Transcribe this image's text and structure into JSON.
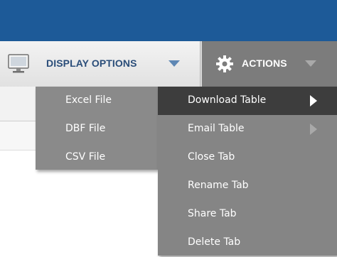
{
  "toolbar": {
    "display_options_label": "DISPLAY OPTIONS",
    "actions_label": "ACTIONS"
  },
  "actions_menu": {
    "items": [
      {
        "label": "Download Table",
        "has_submenu": true,
        "active": true
      },
      {
        "label": "Email Table",
        "has_submenu": true,
        "active": false
      },
      {
        "label": "Close Tab",
        "has_submenu": false,
        "active": false
      },
      {
        "label": "Rename Tab",
        "has_submenu": false,
        "active": false
      },
      {
        "label": "Share Tab",
        "has_submenu": false,
        "active": false
      },
      {
        "label": "Delete Tab",
        "has_submenu": false,
        "active": false
      }
    ]
  },
  "download_submenu": {
    "items": [
      {
        "label": "Excel File"
      },
      {
        "label": "DBF File"
      },
      {
        "label": "CSV File"
      }
    ]
  },
  "icons": {
    "display_options": "monitor-icon",
    "actions": "gear-icon",
    "dropdown": "chevron-down-icon",
    "submenu": "chevron-right-icon"
  },
  "colors": {
    "header_bar": "#1d5a98",
    "menu_background": "#858585",
    "menu_active": "#3d3d3d",
    "display_label": "#2a4d79"
  }
}
